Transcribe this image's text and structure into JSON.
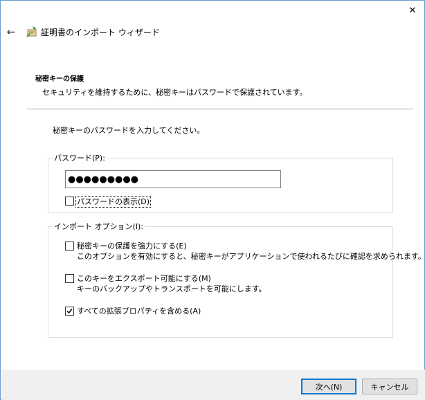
{
  "window": {
    "title": "証明書のインポート ウィザード",
    "close_glyph": "✕",
    "back_glyph": "←"
  },
  "section": {
    "heading": "秘密キーの保護",
    "description": "セキュリティを維持するために、秘密キーはパスワードで保護されています。"
  },
  "instruction": "秘密キーのパスワードを入力してください。",
  "password_group": {
    "label": "パスワード(P):",
    "value": "●●●●●●●●●",
    "show_password": {
      "label": "パスワードの表示(D)",
      "checked": false
    }
  },
  "import_options": {
    "label": "インポート オプション(I):",
    "options": [
      {
        "label": "秘密キーの保護を強力にする(E)",
        "description": "このオプションを有効にすると、秘密キーがアプリケーションで使われるたびに確認を求められます。",
        "checked": false
      },
      {
        "label": "このキーをエクスポート可能にする(M)",
        "description": "キーのバックアップやトランスポートを可能にします。",
        "checked": false
      },
      {
        "label": "すべての拡張プロパティを含める(A)",
        "description": "",
        "checked": true
      }
    ]
  },
  "buttons": {
    "next": "次へ(N)",
    "cancel": "キャンセル"
  },
  "colors": {
    "accent": "#0078d7",
    "footer_bg": "#f0f0f0",
    "group_border": "#dcdcdc"
  }
}
